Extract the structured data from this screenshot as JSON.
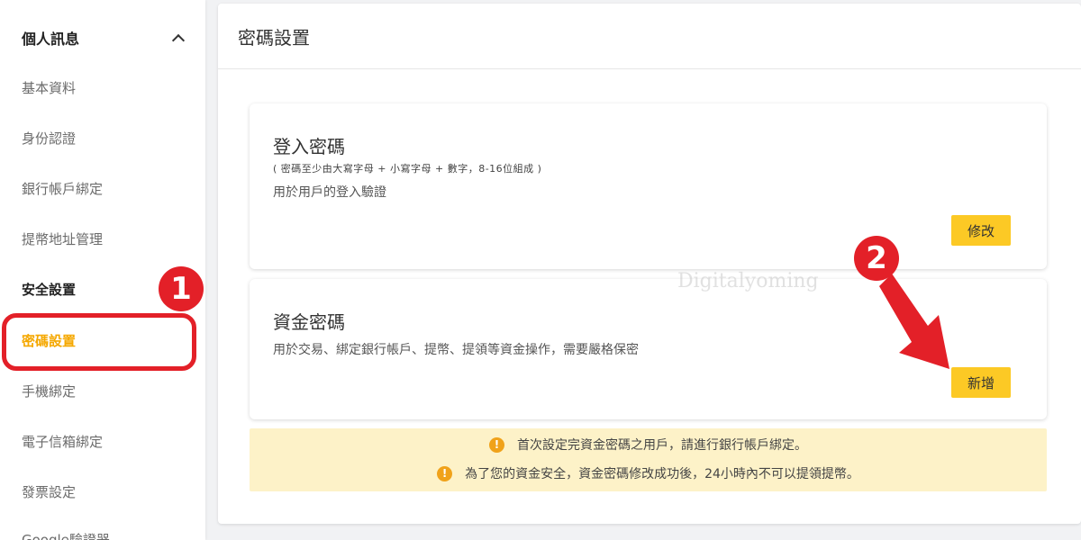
{
  "sidebar": {
    "group_label": "個人訊息",
    "items": [
      {
        "label": "基本資料"
      },
      {
        "label": "身份認證"
      },
      {
        "label": "銀行帳戶綁定"
      },
      {
        "label": "提幣地址管理"
      },
      {
        "label": "安全設置"
      },
      {
        "label": "密碼設置"
      },
      {
        "label": "手機綁定"
      },
      {
        "label": "電子信箱綁定"
      },
      {
        "label": "發票設定"
      },
      {
        "label": "Google驗證器"
      }
    ]
  },
  "main": {
    "title": "密碼設置",
    "login_card": {
      "title": "登入密碼",
      "note": "( 密碼至少由大寫字母 + 小寫字母 + 數字，8-16位組成 )",
      "desc": "用於用戶的登入驗證",
      "button": "修改"
    },
    "fund_card": {
      "title": "資金密碼",
      "desc": "用於交易、綁定銀行帳戶、提幣、提領等資金操作，需要嚴格保密",
      "button": "新增"
    },
    "notices": [
      "首次設定完資金密碼之用戶，請進行銀行帳戶綁定。",
      "為了您的資金安全，資金密碼修改成功後，24小時內不可以提領提幣。"
    ]
  },
  "annotations": {
    "step1": "1",
    "step2": "2",
    "watermark": "Digitalyoming"
  },
  "colors": {
    "accent": "#fcc925",
    "active_text": "#f5a800",
    "annotation_red": "#e32028",
    "notice_bg": "#fdf2c8",
    "warn_icon": "#f0a21a"
  }
}
